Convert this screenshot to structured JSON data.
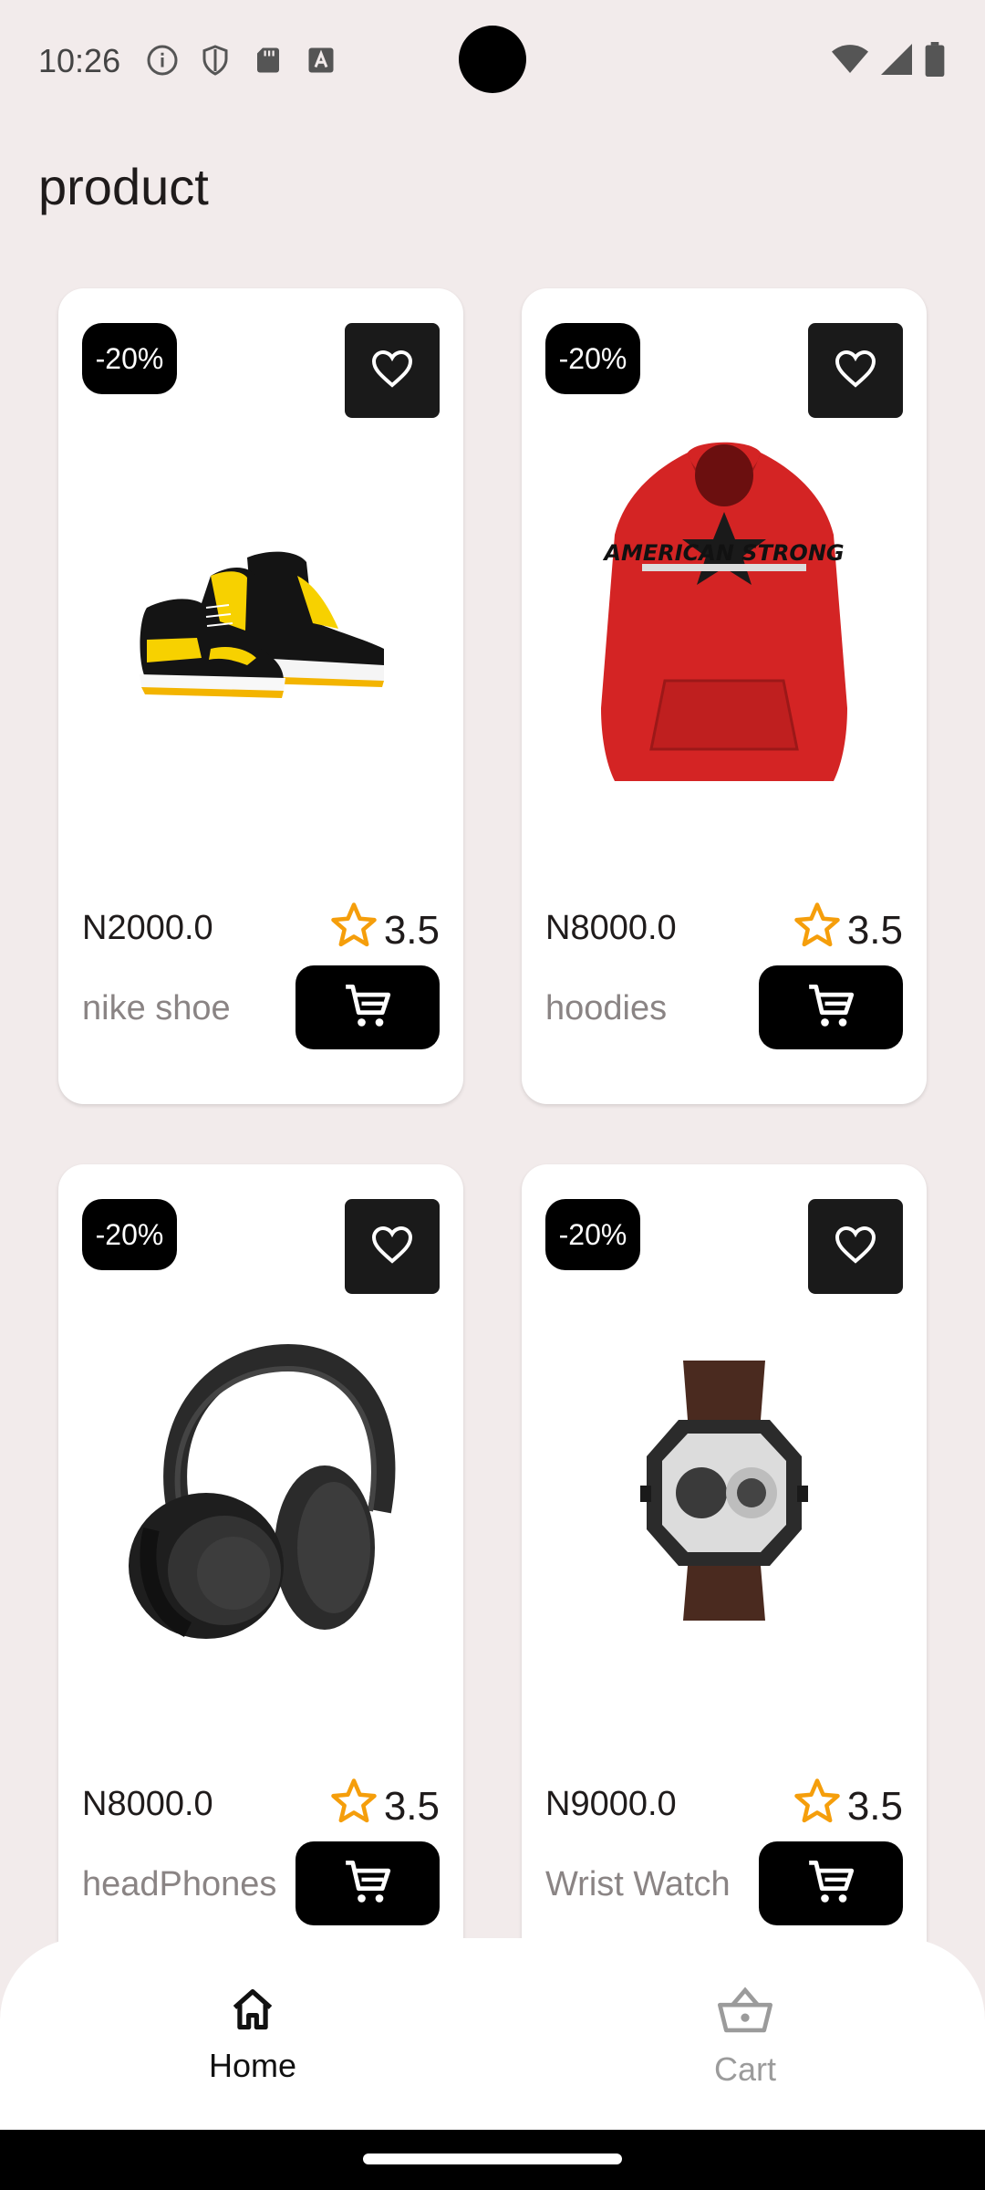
{
  "status_bar": {
    "time": "10:26",
    "left_icons": [
      "info-icon",
      "shield-icon",
      "sd-card-icon",
      "text-a-icon"
    ],
    "right_icons": [
      "wifi-icon",
      "signal-icon",
      "battery-icon"
    ]
  },
  "page": {
    "title": "product"
  },
  "products": [
    {
      "badge": "-20%",
      "price": "N2000.0",
      "rating": "3.5",
      "name": "nike shoe",
      "image": "sneaker-image"
    },
    {
      "badge": "-20%",
      "price": "N8000.0",
      "rating": "3.5",
      "name": "hoodies",
      "image": "hoodie-image",
      "image_text": "AMERICAN STRONG"
    },
    {
      "badge": "-20%",
      "price": "N8000.0",
      "rating": "3.5",
      "name": "headPhones",
      "image": "headphones-image"
    },
    {
      "badge": "-20%",
      "price": "N9000.0",
      "rating": "3.5",
      "name": "Wrist Watch",
      "image": "wristwatch-image"
    }
  ],
  "bottom_nav": {
    "items": [
      {
        "label": "Home",
        "icon": "home-icon",
        "active": true
      },
      {
        "label": "Cart",
        "icon": "basket-icon",
        "active": false
      }
    ]
  },
  "colors": {
    "background": "#f2ebeb",
    "card": "#ffffff",
    "button": "#000000",
    "star": "#f59e0b",
    "muted_text": "#8a8484"
  }
}
